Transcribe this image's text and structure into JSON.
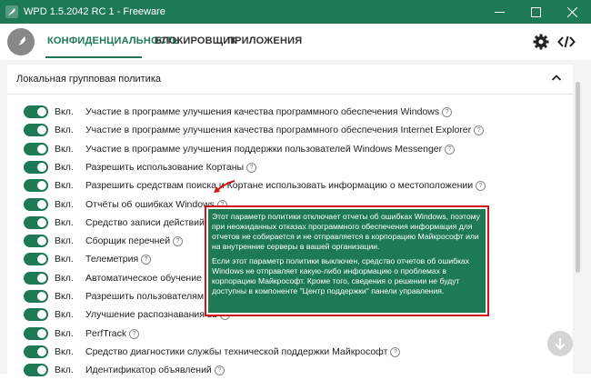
{
  "window": {
    "title": "WPD 1.5.2042 RC 1 - Freeware"
  },
  "tabs": [
    {
      "label": "КОНФИДЕНЦИАЛЬНОСТЬ",
      "active": true
    },
    {
      "label": "БЛОКИРОВЩИК",
      "active": false
    },
    {
      "label": "ПРИЛОЖЕНИЯ",
      "active": false
    }
  ],
  "section": {
    "title": "Локальная групповая политика"
  },
  "rows": [
    {
      "state": "Вкл.",
      "label": "Участие в программе улучшения качества программного обеспечения Windows"
    },
    {
      "state": "Вкл.",
      "label": "Участие в программе улучшения качества программного обеспечения Internet Explorer"
    },
    {
      "state": "Вкл.",
      "label": "Участие в программе улучшения поддержки пользователей Windows Messenger"
    },
    {
      "state": "Вкл.",
      "label": "Разрешить использование Кортаны"
    },
    {
      "state": "Вкл.",
      "label": "Разрешить средствам поиска и Кортане использовать информацию о местоположении"
    },
    {
      "state": "Вкл.",
      "label": "Отчёты об ошибках Windows"
    },
    {
      "state": "Вкл.",
      "label": "Средство записи действий"
    },
    {
      "state": "Вкл.",
      "label": "Сборщик перечней"
    },
    {
      "state": "Вкл.",
      "label": "Телеметрия"
    },
    {
      "state": "Вкл.",
      "label": "Автоматическое обучение ра"
    },
    {
      "state": "Вкл.",
      "label": "Разрешить пользователям вкл"
    },
    {
      "state": "Вкл.",
      "label": "Улучшение распознавания вв"
    },
    {
      "state": "Вкл.",
      "label": "PerfTrack"
    },
    {
      "state": "Вкл.",
      "label": "Средство диагностики службы технической поддержки Майкрософт"
    },
    {
      "state": "Вкл.",
      "label": "Идентификатор объявлений"
    }
  ],
  "tooltip": {
    "paragraph1": "Этот параметр политики отключает отчеты об ошибках Windows, поэтому при неожиданных отказах программного обеспечения информация для отчетов не собирается и не отправляется в корпорацию Майкрософт или на внутренние серверы в вашей организации.",
    "paragraph2": "Если этот параметр политики выключен, средство отчетов об ошибках Windows не отправляет какую-либо информацию о проблемах в корпорацию Майкрософт. Кроме того, сведения о решении не будут доступны в компоненте \"Центр поддержки\" панели управления."
  },
  "icons": {
    "app": "feather-app-icon",
    "logo": "feather-logo-icon",
    "settings": "gear-icon",
    "code": "code-icon",
    "collapse": "chevron-up-icon",
    "help": "help-circle-icon",
    "scroll_down": "arrow-down-icon"
  },
  "colors": {
    "accent": "#1e7a55",
    "highlight": "#d21414"
  }
}
